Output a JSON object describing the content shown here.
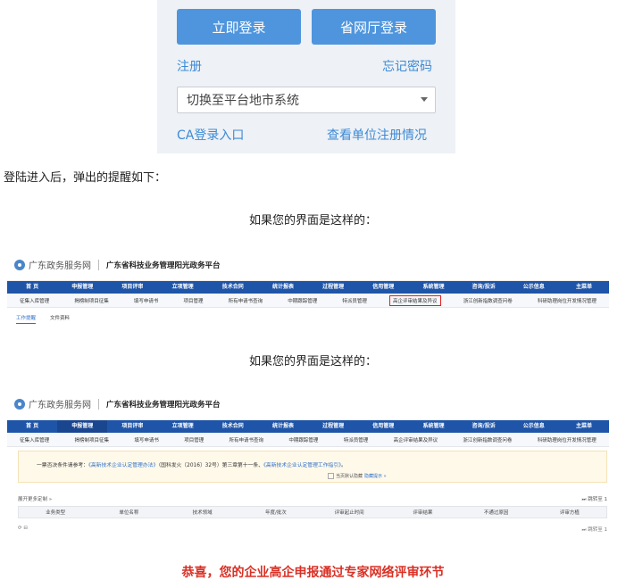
{
  "login": {
    "login_button": "立即登录",
    "province_button": "省网厅登录",
    "register_link": "注册",
    "forgot_link": "忘记密码",
    "city_select": "切换至平台地市系统",
    "ca_link": "CA登录入口",
    "unit_link": "查看单位注册情况"
  },
  "caption_intro": "登陆进入后，弹出的提醒如下：",
  "caption_case": "如果您的界面是这样的：",
  "portal": {
    "brand": "广东政务服务网",
    "title": "广东省科技业务管理阳光政务平台",
    "nav": [
      "首 页",
      "申报管理",
      "项目评审",
      "立项管理",
      "技术合同",
      "统计报表",
      "过程管理",
      "信用管理",
      "系统管理",
      "咨询/投诉",
      "公示信息",
      "主菜单"
    ],
    "subnav": [
      "征集入库管理",
      "揭榜制项目征集",
      "填写申请书",
      "项目管理",
      "所有申请书查询",
      "中期跟踪管理",
      "特派员管理",
      "高企评审结果及异议",
      "浙江创新指数调查问卷",
      "科研助理岗位开发情况管理"
    ],
    "tabs": [
      "工作提醒",
      "文件资料"
    ],
    "notice_prefix": "一票否决条件请参考：",
    "notice_link1": "《高新技术企业认定管理办法》",
    "notice_mid": "（国科发火〔2016〕32号）第三章第十一条、",
    "notice_link2": "《高新技术企业认定管理工作指引》",
    "notice_suffix": "。",
    "notice_check": "当页默认隐藏",
    "notice_hide": "隐藏提示 »",
    "table_expand": "展开更多定制 »",
    "table_page": "⏭ 跳转至 1",
    "table_headers": [
      "业务类型",
      "单位名称",
      "技术领域",
      "年度/批次",
      "评审起止时间",
      "评审结果",
      "不通过原因",
      "评审方植"
    ],
    "table_refresh": "⟳ ⊟",
    "table_page2": "⏭ 跳转至 1"
  },
  "congrats": "恭喜，您的企业高企申报通过专家网络评审环节"
}
